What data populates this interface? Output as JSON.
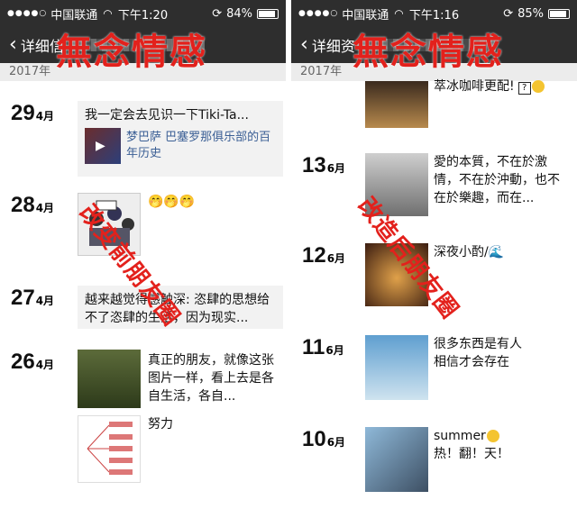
{
  "left": {
    "status": {
      "dots": "●●●●○",
      "carrier": "中国联通",
      "time": "下午1:20",
      "battery": "84%",
      "battery_level": 0.84
    },
    "nav": {
      "back_label": "详细信"
    },
    "year": "2017年",
    "entries": [
      {
        "day": "29",
        "mon": "4月",
        "text": "我一定会去见识一下Tiki-Ta...",
        "link_text": "梦巴萨 巴塞罗那俱乐部的百年历史"
      },
      {
        "day": "28",
        "mon": "4月",
        "emoji_text": "🤭🤭🤭"
      },
      {
        "day": "27",
        "mon": "4月",
        "text": "越来越觉得感触深: 恣肆的思想给不了恣肆的生活，因为现实..."
      },
      {
        "day": "26",
        "mon": "4月",
        "text": "真正的朋友，就像这张图片一样，看上去是各自生活，各自...",
        "text2": "努力"
      }
    ]
  },
  "right": {
    "status": {
      "dots": "●●●●○",
      "carrier": "中国联通",
      "time": "下午1:16",
      "battery": "85%",
      "battery_level": 0.85
    },
    "nav": {
      "back_label": "详细资"
    },
    "year": "2017年",
    "top_text": "萃冰咖啡更配!",
    "top_q": "?",
    "entries": [
      {
        "day": "13",
        "mon": "6月",
        "text": "愛的本質，不在於激情，不在於沖動，也不在於樂趣，而在..."
      },
      {
        "day": "12",
        "mon": "6月",
        "text": "深夜小酌/🌊"
      },
      {
        "day": "11",
        "mon": "6月",
        "text": "很多东西是有人相信才会存在"
      },
      {
        "day": "10",
        "mon": "6月",
        "text": "summer",
        "text2": "热！翻！天！"
      }
    ]
  },
  "watermarks": {
    "title": "無念情感",
    "left_vertical": "改变前朋友圈",
    "right_vertical": "改造后朋友圈"
  },
  "colors": {
    "status_bg": "#2e2e2e",
    "watermark": "#e3211c",
    "link": "#3b5f95",
    "bubble": "#f2f2f2"
  }
}
